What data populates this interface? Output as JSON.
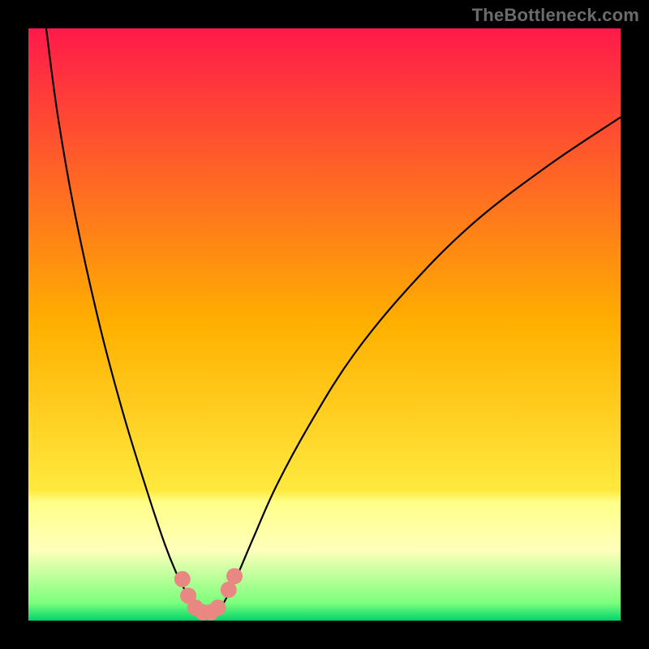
{
  "watermark": "TheBottleneck.com",
  "chart_data": {
    "type": "line",
    "title": "",
    "xlabel": "",
    "ylabel": "",
    "xlim": [
      0,
      100
    ],
    "ylim": [
      0,
      100
    ],
    "grid": false,
    "legend": false,
    "background_gradient": [
      {
        "pos": 0.0,
        "color": "#ff1a4a"
      },
      {
        "pos": 0.5,
        "color": "#ffb000"
      },
      {
        "pos": 0.78,
        "color": "#ffe93e"
      },
      {
        "pos": 0.8,
        "color": "#ffff88"
      },
      {
        "pos": 0.88,
        "color": "#ffffbb"
      },
      {
        "pos": 0.97,
        "color": "#7cff7c"
      },
      {
        "pos": 1.0,
        "color": "#00d46a"
      }
    ],
    "series": [
      {
        "name": "left-curve",
        "x": [
          3,
          5,
          8,
          12,
          16,
          20,
          23,
          25,
          26.5,
          27.5
        ],
        "values": [
          100,
          85,
          68,
          50,
          35,
          22,
          13,
          8,
          5,
          3
        ]
      },
      {
        "name": "right-curve",
        "x": [
          33,
          35,
          38,
          42,
          48,
          55,
          64,
          75,
          88,
          100
        ],
        "values": [
          3,
          7,
          14,
          23,
          34,
          45,
          56,
          67,
          77,
          85
        ]
      },
      {
        "name": "valley-bottom",
        "x": [
          27.5,
          28.5,
          29.5,
          30.5,
          31.5,
          32.5,
          33
        ],
        "values": [
          3,
          1.8,
          1.3,
          1.2,
          1.4,
          2.0,
          3
        ]
      }
    ],
    "scatter_markers": {
      "name": "valley-markers",
      "color": "#e98783",
      "radius": 10,
      "points": [
        {
          "x": 26.0,
          "y": 7.0
        },
        {
          "x": 27.0,
          "y": 4.2
        },
        {
          "x": 28.2,
          "y": 2.2
        },
        {
          "x": 29.5,
          "y": 1.4
        },
        {
          "x": 30.8,
          "y": 1.4
        },
        {
          "x": 32.0,
          "y": 2.2
        },
        {
          "x": 33.8,
          "y": 5.2
        },
        {
          "x": 34.8,
          "y": 7.5
        }
      ]
    }
  }
}
